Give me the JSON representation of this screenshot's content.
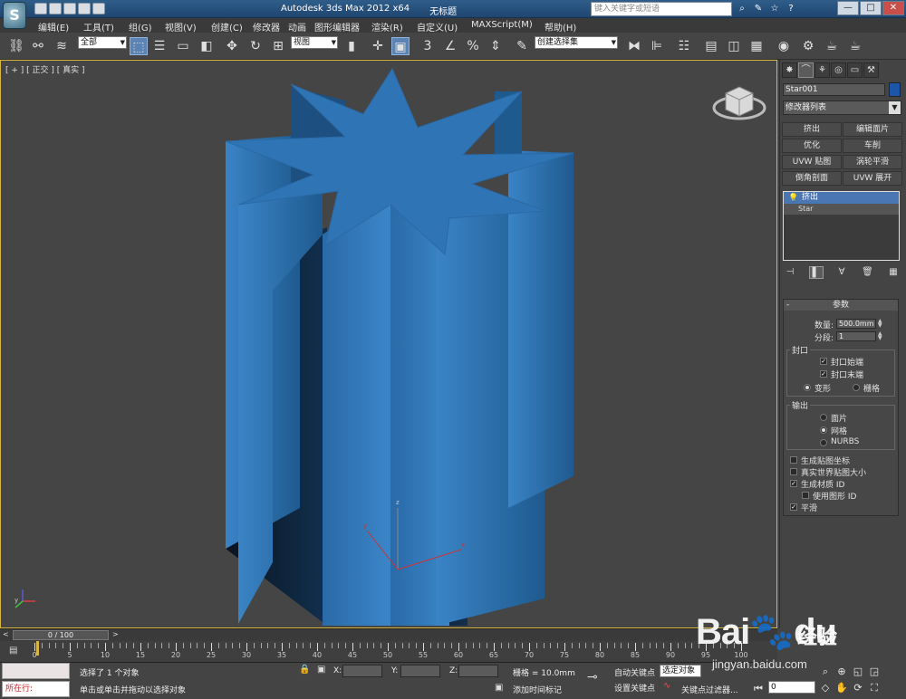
{
  "window": {
    "app_title": "Autodesk 3ds Max  2012 x64",
    "doc_title": "无标题",
    "search_placeholder": "键入关键字或短语",
    "min": "—",
    "max": "□",
    "close": "✕"
  },
  "menu": [
    "编辑(E)",
    "工具(T)",
    "组(G)",
    "视图(V)",
    "创建(C)",
    "修改器",
    "动画",
    "图形编辑器",
    "渲染(R)",
    "自定义(U)",
    "MAXScript(M)",
    "帮助(H)"
  ],
  "toolbar": {
    "selection_filter": "全部",
    "ref_coord": "视图",
    "named_selection": "创建选择集",
    "snap_3": "3",
    "percent": "%"
  },
  "viewport": {
    "label": "[ + ] [ 正交 ] [ 真实 ]",
    "axis_z": "z",
    "axis_y": "y",
    "axis_x": "x",
    "object_color": "#2e6fa8"
  },
  "command_panel": {
    "object_name": "Star001",
    "object_color": "#1c56a8",
    "modifier_list": "修改器列表",
    "modifier_buttons": [
      "挤出",
      "编辑面片",
      "优化",
      "车削",
      "UVW 贴图",
      "涡轮平滑",
      "倒角剖面",
      "UVW 展开"
    ],
    "stack": {
      "top": "挤出",
      "base": "Star"
    },
    "params": {
      "title": "参数",
      "amount_label": "数量:",
      "amount_value": "500.0mm",
      "segments_label": "分段:",
      "segments_value": "1",
      "capping_group": "封口",
      "cap_start": "封口始端",
      "cap_end": "封口末端",
      "morph": "变形",
      "grid": "栅格",
      "output_group": "输出",
      "patch": "面片",
      "mesh": "网格",
      "nurbs": "NURBS",
      "gen_map_coords": "生成贴图坐标",
      "real_world_map": "真实世界贴图大小",
      "gen_mat_ids": "生成材质 ID",
      "use_shape_ids": "使用图形 ID",
      "smooth": "平滑"
    }
  },
  "timeline": {
    "slider_text": "0 / 100",
    "ticks": [
      "0",
      "5",
      "10",
      "15",
      "20",
      "25",
      "30",
      "35",
      "40",
      "45",
      "50",
      "55",
      "60",
      "65",
      "70",
      "75",
      "80",
      "85",
      "90",
      "95",
      "100"
    ]
  },
  "status": {
    "maxscript_prompt": "所在行:",
    "selected_text": "选择了 1 个对象",
    "prompt_text": "单击或单击并拖动以选择对象",
    "x_label": "X:",
    "y_label": "Y:",
    "z_label": "Z:",
    "grid_text": "栅格 = 10.0mm",
    "add_time_tag": "添加时间标记",
    "auto_key": "自动关键点",
    "set_key": "设置关键点",
    "selected_dropdown": "选定对象",
    "key_filters": "关键点过滤器...",
    "frame_value": "0"
  },
  "watermark": {
    "brand": "Bai",
    "brand2": "du",
    "cn": "经验",
    "url": "jingyan.baidu.com"
  }
}
